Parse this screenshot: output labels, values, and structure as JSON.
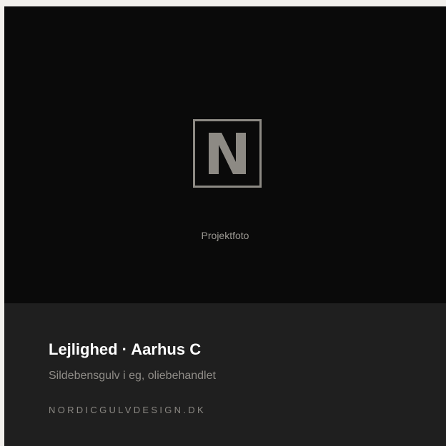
{
  "photo": {
    "logo_icon": "nordic-n-logo-icon",
    "label": "Projektfoto"
  },
  "project": {
    "title": "Lejlighed · Aarhus C",
    "description": "Sildebensgulv i eg, oliebehandlet",
    "website": "NORDICGULVDESIGN.DK"
  },
  "colors": {
    "logo": "#8d8a84",
    "photo_background": "#0a0a0a",
    "info_background": "#1f1f1f"
  }
}
